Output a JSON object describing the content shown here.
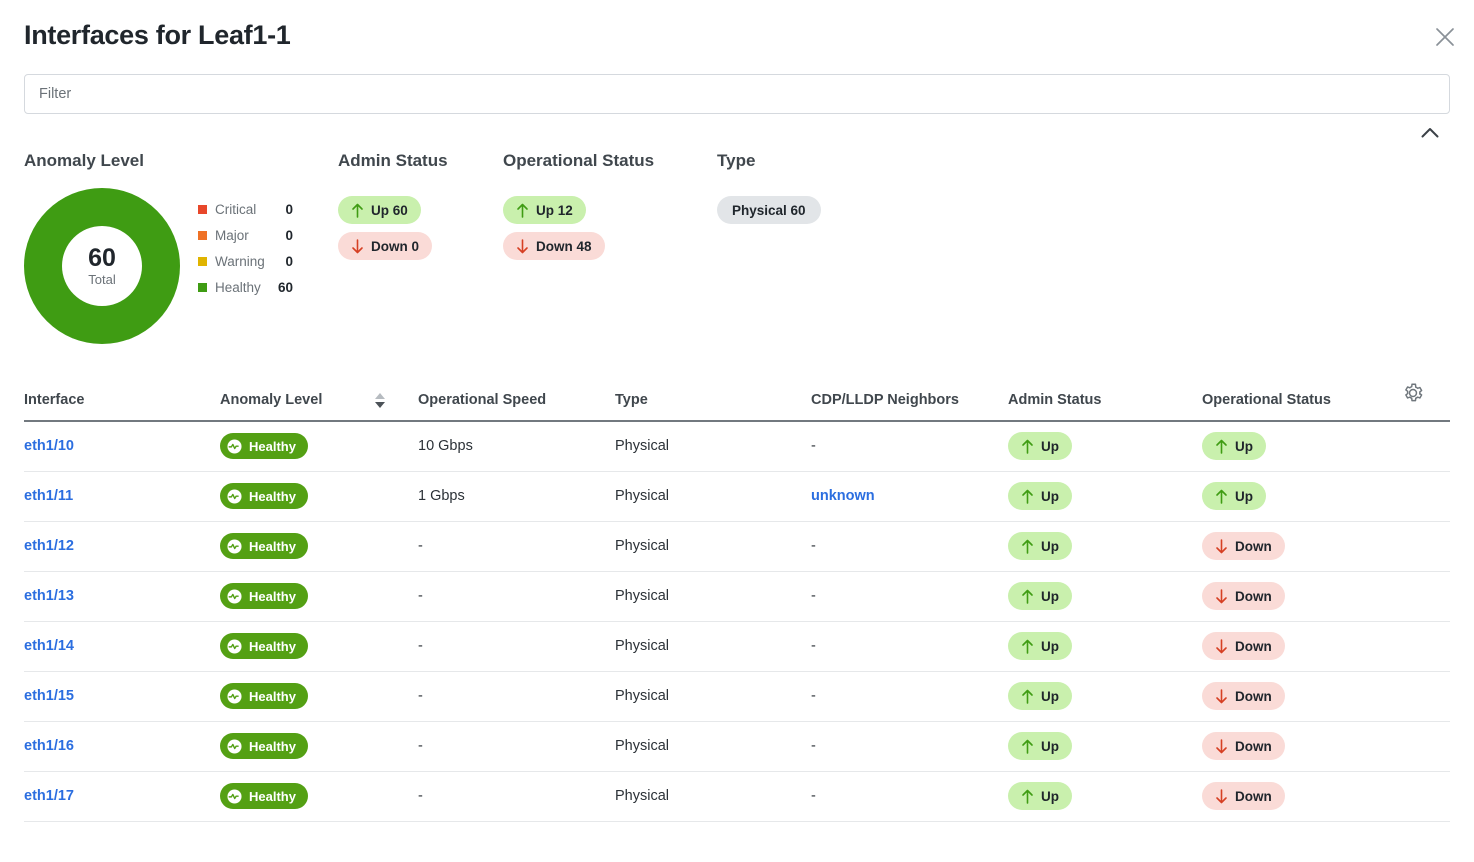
{
  "header": {
    "title": "Interfaces for Leaf1-1",
    "close_icon": "close-icon"
  },
  "filter": {
    "placeholder": "Filter",
    "value": ""
  },
  "summary": {
    "collapse_icon": "chevron-up-icon",
    "anomaly": {
      "title": "Anomaly Level",
      "total_value": "60",
      "total_label": "Total",
      "legend": [
        {
          "label": "Critical",
          "value": "0",
          "color": "#e8472a"
        },
        {
          "label": "Major",
          "value": "0",
          "color": "#ef7125"
        },
        {
          "label": "Warning",
          "value": "0",
          "color": "#e0b400"
        },
        {
          "label": "Healthy",
          "value": "60",
          "color": "#3f9c13"
        }
      ]
    },
    "admin_status": {
      "title": "Admin Status",
      "chips": [
        {
          "label": "Up 60",
          "kind": "up"
        },
        {
          "label": "Down 0",
          "kind": "down"
        }
      ]
    },
    "operational_status": {
      "title": "Operational Status",
      "chips": [
        {
          "label": "Up 12",
          "kind": "up"
        },
        {
          "label": "Down 48",
          "kind": "down"
        }
      ]
    },
    "type": {
      "title": "Type",
      "chips": [
        {
          "label": "Physical 60",
          "kind": "neutral"
        }
      ]
    }
  },
  "table": {
    "columns": [
      "Interface",
      "Anomaly Level",
      "Operational Speed",
      "Type",
      "CDP/LLDP Neighbors",
      "Admin Status",
      "Operational Status"
    ],
    "sort": {
      "column": "Anomaly Level",
      "direction": "desc"
    },
    "settings_icon": "gear-icon",
    "rows": [
      {
        "interface": "eth1/10",
        "anomaly": "Healthy",
        "speed": "10 Gbps",
        "type": "Physical",
        "neighbors": "-",
        "neighbors_link": false,
        "admin": "Up",
        "oper": "Up"
      },
      {
        "interface": "eth1/11",
        "anomaly": "Healthy",
        "speed": "1 Gbps",
        "type": "Physical",
        "neighbors": "unknown",
        "neighbors_link": true,
        "admin": "Up",
        "oper": "Up"
      },
      {
        "interface": "eth1/12",
        "anomaly": "Healthy",
        "speed": "-",
        "type": "Physical",
        "neighbors": "-",
        "neighbors_link": false,
        "admin": "Up",
        "oper": "Down"
      },
      {
        "interface": "eth1/13",
        "anomaly": "Healthy",
        "speed": "-",
        "type": "Physical",
        "neighbors": "-",
        "neighbors_link": false,
        "admin": "Up",
        "oper": "Down"
      },
      {
        "interface": "eth1/14",
        "anomaly": "Healthy",
        "speed": "-",
        "type": "Physical",
        "neighbors": "-",
        "neighbors_link": false,
        "admin": "Up",
        "oper": "Down"
      },
      {
        "interface": "eth1/15",
        "anomaly": "Healthy",
        "speed": "-",
        "type": "Physical",
        "neighbors": "-",
        "neighbors_link": false,
        "admin": "Up",
        "oper": "Down"
      },
      {
        "interface": "eth1/16",
        "anomaly": "Healthy",
        "speed": "-",
        "type": "Physical",
        "neighbors": "-",
        "neighbors_link": false,
        "admin": "Up",
        "oper": "Down"
      },
      {
        "interface": "eth1/17",
        "anomaly": "Healthy",
        "speed": "-",
        "type": "Physical",
        "neighbors": "-",
        "neighbors_link": false,
        "admin": "Up",
        "oper": "Down"
      }
    ]
  },
  "chart_data": {
    "type": "pie",
    "title": "Anomaly Level",
    "categories": [
      "Critical",
      "Major",
      "Warning",
      "Healthy"
    ],
    "values": [
      0,
      0,
      0,
      60
    ],
    "colors": [
      "#e8472a",
      "#ef7125",
      "#e0b400",
      "#3f9c13"
    ],
    "total": 60,
    "center_label": "Total",
    "legend_position": "right",
    "donut": true
  }
}
